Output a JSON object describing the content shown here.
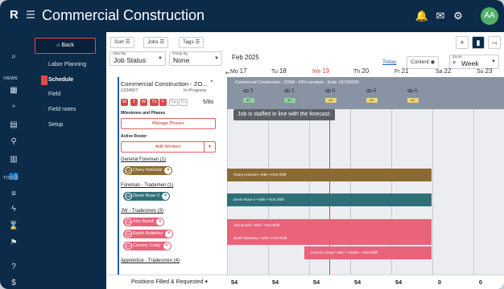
{
  "app": {
    "logo": "R",
    "title": "Commercial Construction",
    "avatar": "AA"
  },
  "rail": {
    "views_label": "VIEWS",
    "tools_label": "TOOLS"
  },
  "menu": {
    "back": "Back",
    "items": [
      "Labor Planning",
      "Schedule",
      "Field",
      "Field notes",
      "Setup"
    ]
  },
  "toolbar": {
    "sort": "Sort",
    "jobs": "Jobs",
    "tags": "Tags"
  },
  "controls": {
    "view_by_label": "View By",
    "view_by": "Job Status",
    "group_by_label": "Group By",
    "group_by": "None",
    "period": "Feb 2025",
    "today": "Today",
    "content": "Content",
    "zoom_label": "Zoom",
    "zoom": "Week"
  },
  "days": [
    {
      "dow": "Mo",
      "num": "17",
      "today": false
    },
    {
      "dow": "Tu",
      "num": "18",
      "today": false
    },
    {
      "dow": "We",
      "num": "19",
      "today": true
    },
    {
      "dow": "Th",
      "num": "20",
      "today": false
    },
    {
      "dow": "Fr",
      "num": "21",
      "today": false
    },
    {
      "dow": "Sa",
      "num": "22",
      "today": false
    },
    {
      "dow": "Su",
      "num": "23",
      "today": false
    }
  ],
  "job": {
    "title": "Commercial Construction - ZO...",
    "id": "1234567",
    "status": "In-Progress",
    "days": [
      "M",
      "T",
      "W",
      "Th",
      "F",
      "Sa",
      "Su"
    ],
    "shift": "5/8s",
    "milestones_label": "Milestones and Phases",
    "manage_phases": "Manage Phases",
    "roster_label": "Active Roster",
    "add_workers": "Add Workers",
    "roles": [
      {
        "label": "General Foreman (1)",
        "workers": [
          {
            "initials": "CK",
            "name": "Chery Kmicicki"
          }
        ]
      },
      {
        "label": "Foreman - Trademen (1)",
        "workers": [
          {
            "initials": "DR",
            "name": "Devin Rose II"
          }
        ]
      },
      {
        "label": "JW - Tradesmen (3)",
        "workers": [
          {
            "initials": "AB",
            "name": "Abe Buzell"
          },
          {
            "initials": "BB",
            "name": "Butch Butterley"
          },
          {
            "initials": "CC",
            "name": "Conney Custy"
          }
        ]
      },
      {
        "label": "Apprentice - Tradesmen (4)",
        "workers": []
      }
    ]
  },
  "timeline": {
    "banner": "Commercial Construction - ZONA - 24% complete - Ends: 02/19/2026",
    "staff": [
      {
        "count": "5",
        "fill": "7"
      },
      {
        "count": "5",
        "fill": "7"
      },
      {
        "count": "6",
        "fill": "1"
      },
      {
        "count": "6",
        "fill": "1"
      },
      {
        "count": "6",
        "fill": "1"
      }
    ],
    "tooltip": "Job is staffed in line with the forecast.",
    "bars": [
      "Chery Kmicicki • 5/8s • First Shift",
      "Devin Rose II • 5/8s • First Shift",
      "Abe Buzell • 5/8s • First Shift",
      "Butch Butterley • 5/8s • First Shift",
      "Conney Custy • 5/8s • 7:00am - First Shift"
    ]
  },
  "footer": {
    "select": "Positions Filled & Requested",
    "values": [
      "54",
      "54",
      "54",
      "54",
      "54",
      "0",
      "0"
    ]
  },
  "colors": {
    "navy": "#0c2b48",
    "red": "#d64a4a",
    "brown": "#8c6b33",
    "teal": "#2f6f78",
    "pink": "#e9637b",
    "green": "#52b06b"
  }
}
